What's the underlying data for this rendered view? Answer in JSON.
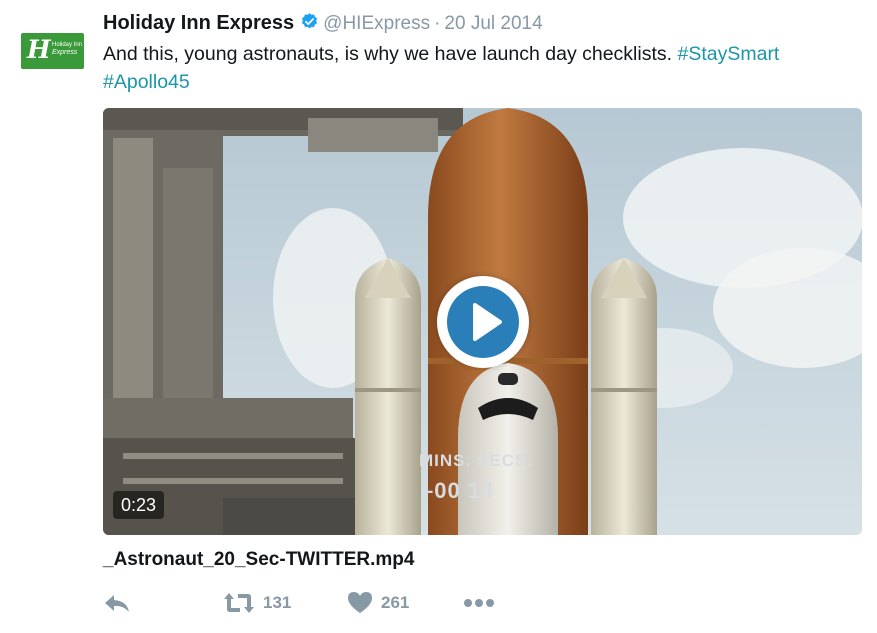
{
  "tweet": {
    "author_name": "Holiday Inn Express",
    "handle": "@HIExpress",
    "separator": "·",
    "date": "20 Jul 2014",
    "text": "And this, young astronauts, is why we have launch day checklists.",
    "hashtags": [
      "#StaySmart",
      "#Apollo45"
    ],
    "avatar": {
      "logo_letter": "H",
      "brand_line1": "Holiday Inn",
      "brand_line2": "Express",
      "color": "#3a9a3a"
    },
    "verified_icon": "verified-badge-icon"
  },
  "media": {
    "duration": "0:23",
    "filename": "_Astronaut_20_Sec-TWITTER.mp4",
    "overlay_line1": "MINS. SECS.",
    "overlay_line2": "–00  14",
    "play_icon": "play-icon"
  },
  "actions": {
    "reply_icon": "reply-icon",
    "retweet_icon": "retweet-icon",
    "retweet_count": "131",
    "like_icon": "heart-icon",
    "like_count": "261",
    "more_icon": "more-icon"
  },
  "colors": {
    "hashtag": "#1b95a8",
    "muted": "#8899a6",
    "play": "#2b7fb8",
    "verified": "#1da1f2"
  }
}
